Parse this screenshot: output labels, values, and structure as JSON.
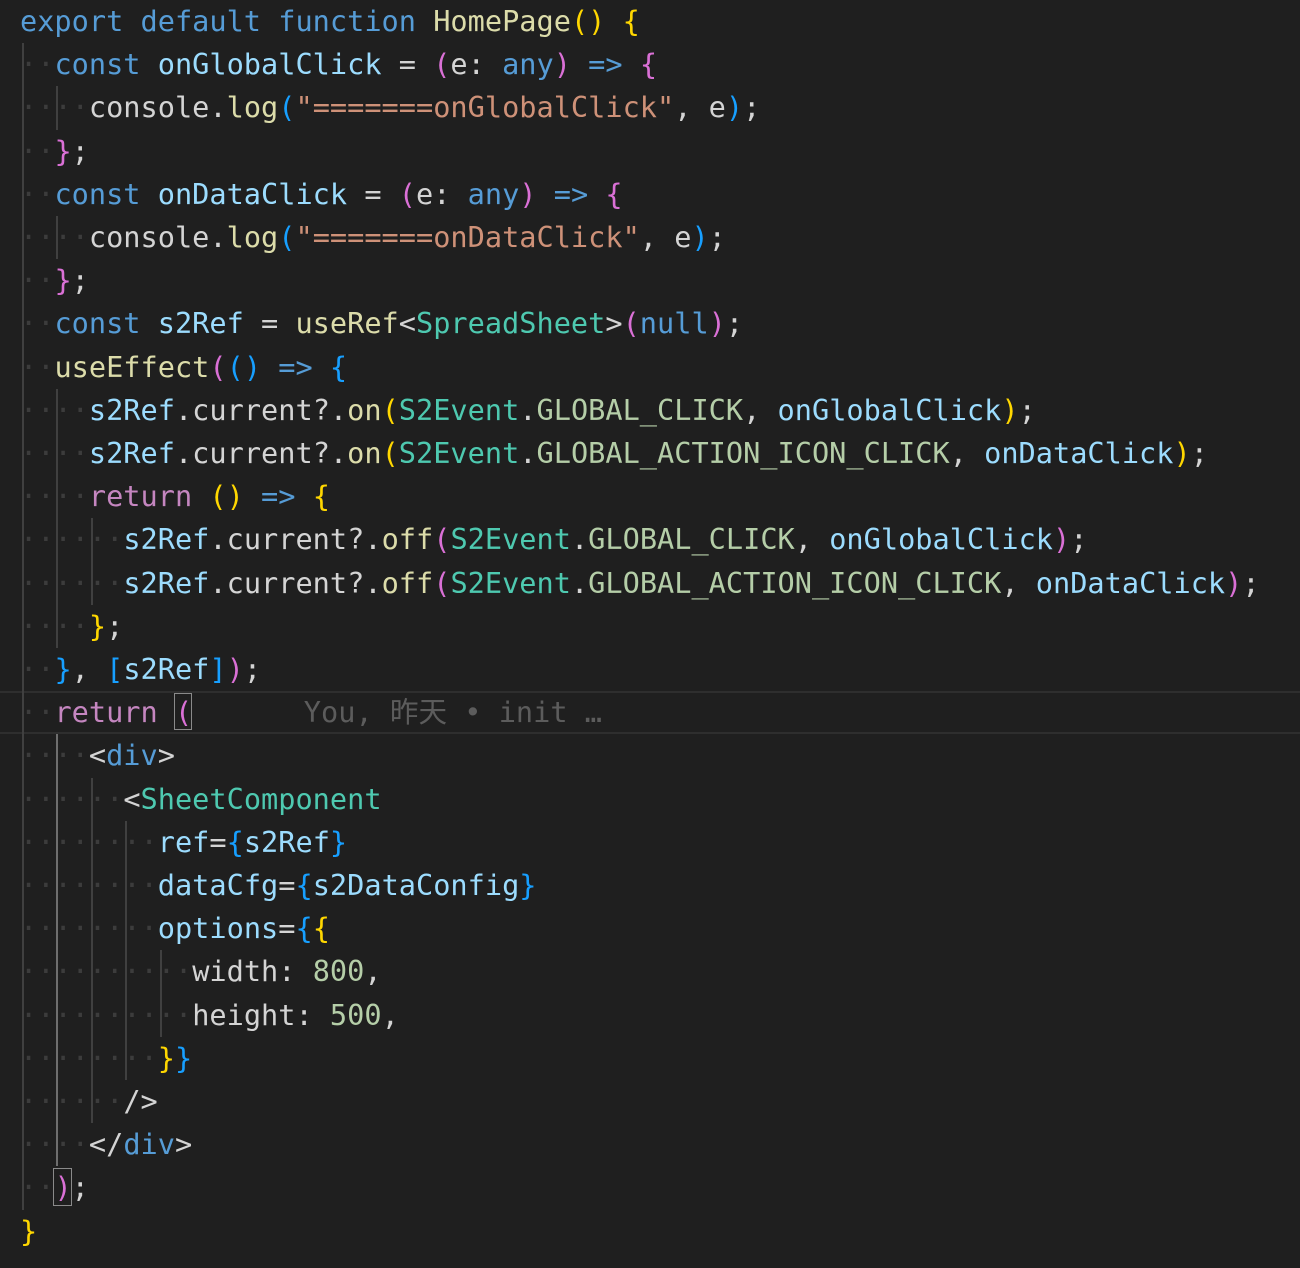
{
  "editor": {
    "lines": [
      "export default function HomePage() {",
      "  const onGlobalClick = (e: any) => {",
      "    console.log(\"=======onGlobalClick\", e);",
      "  };",
      "  const onDataClick = (e: any) => {",
      "    console.log(\"=======onDataClick\", e);",
      "  };",
      "  const s2Ref = useRef<SpreadSheet>(null);",
      "  useEffect(() => {",
      "    s2Ref.current?.on(S2Event.GLOBAL_CLICK, onGlobalClick);",
      "    s2Ref.current?.on(S2Event.GLOBAL_ACTION_ICON_CLICK, onDataClick);",
      "    return () => {",
      "      s2Ref.current?.off(S2Event.GLOBAL_CLICK, onGlobalClick);",
      "      s2Ref.current?.off(S2Event.GLOBAL_ACTION_ICON_CLICK, onDataClick);",
      "    };",
      "  }, [s2Ref]);",
      "  return (",
      "    <div>",
      "      <SheetComponent",
      "        ref={s2Ref}",
      "        dataCfg={s2DataConfig}",
      "        options={{",
      "          width: 800,",
      "          height: 500,",
      "        }}",
      "      />",
      "    </div>",
      "  );",
      "}"
    ],
    "blame_annotation": "You, 昨天 • init …",
    "colors": {
      "background": "#1f1f1f",
      "keyword": "#569cd6",
      "control_keyword": "#c586c0",
      "function": "#dcdcaa",
      "variable": "#9cdcfe",
      "type": "#4ec9b0",
      "string": "#ce9178",
      "number": "#b5cea8",
      "bracket_1": "#ffd700",
      "bracket_2": "#da70d6",
      "bracket_3": "#179fff",
      "blame": "#5c5c5c"
    }
  }
}
